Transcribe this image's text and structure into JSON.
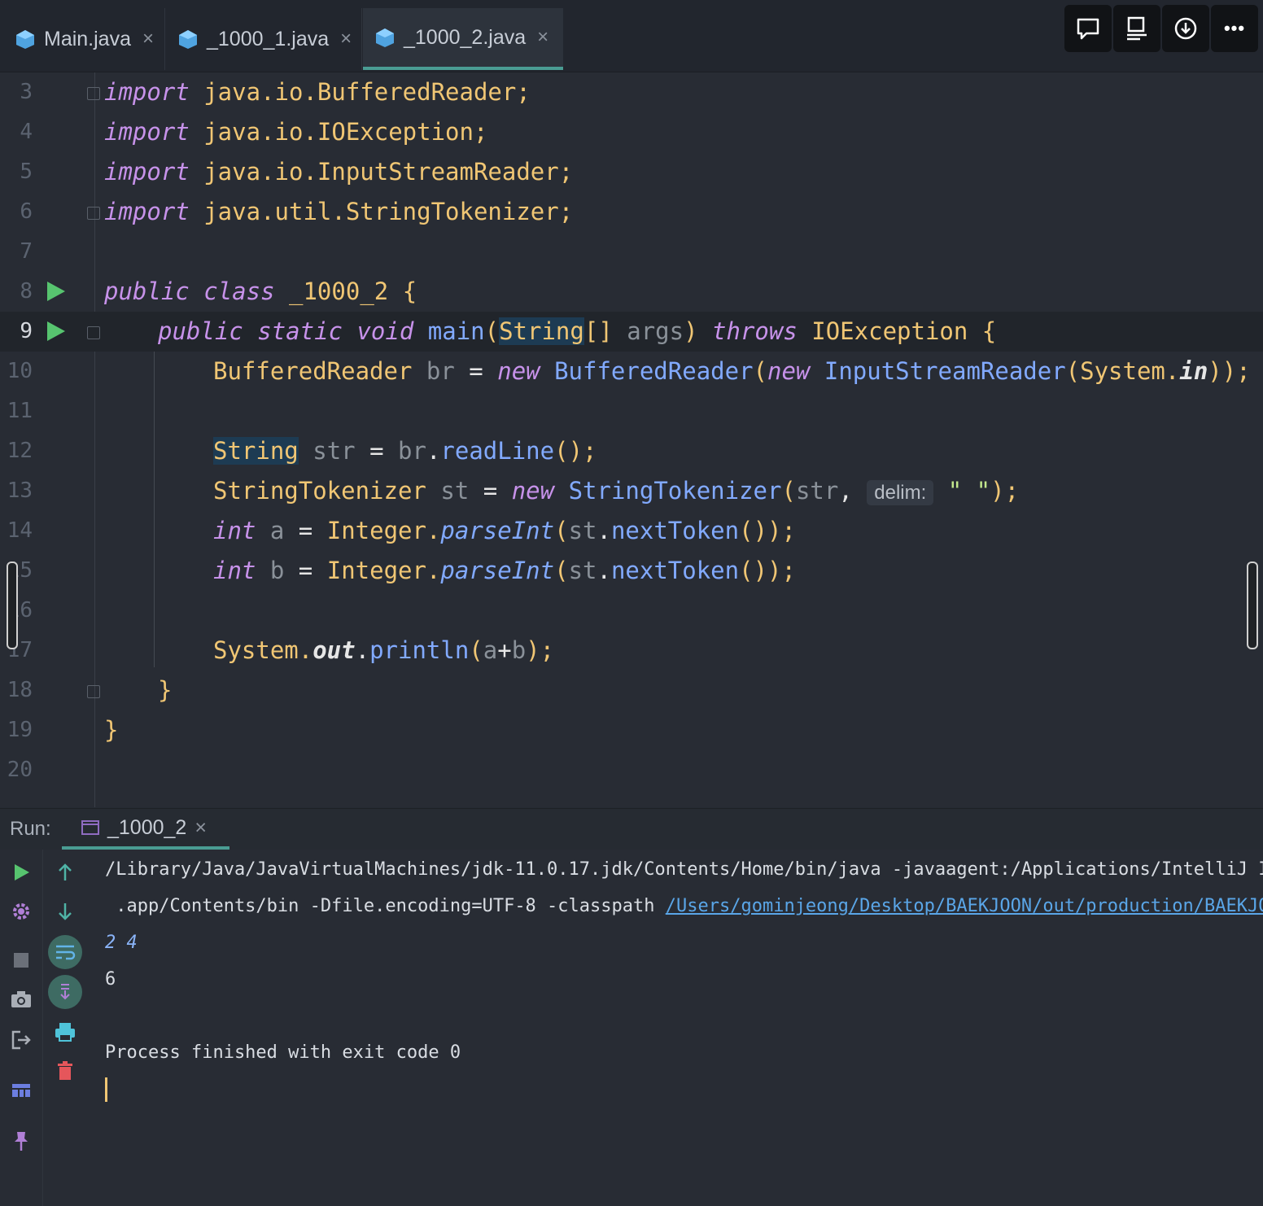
{
  "tabs": [
    {
      "label": "Main.java",
      "close": "×",
      "active": false
    },
    {
      "label": "_1000_1.java",
      "close": "×",
      "active": false
    },
    {
      "label": "_1000_2.java",
      "close": "×",
      "active": true
    }
  ],
  "toolbar": {
    "icons": [
      "comment-icon",
      "presentation-icon",
      "download-icon",
      "more-icon"
    ],
    "more_label": "•••"
  },
  "editor": {
    "line_numbers": [
      "3",
      "4",
      "5",
      "6",
      "7",
      "8",
      "9",
      "10",
      "11",
      "12",
      "13",
      "14",
      "15",
      "16",
      "17",
      "18",
      "19",
      "20"
    ],
    "current_line": "9",
    "lines": {
      "l3": {
        "kw": "import",
        "rest": " java.io.BufferedReader;"
      },
      "l4": {
        "kw": "import",
        "rest": " java.io.IOException;"
      },
      "l5": {
        "kw": "import",
        "rest": " java.io.InputStreamReader;"
      },
      "l6": {
        "kw": "import",
        "rest": " java.util.StringTokenizer;"
      },
      "l8": {
        "kw1": "public",
        "kw2": "class",
        "name": "_1000_2",
        "brace": "{"
      },
      "l9": {
        "kw1": "public",
        "kw2": "static",
        "kw3": "void",
        "fn": "main",
        "p1": "(",
        "type": "String",
        "arr": "[]",
        "arg": "args",
        "p2": ")",
        "kw4": "throws",
        "exc": "IOException",
        "brace": "{"
      },
      "l10": {
        "type": "BufferedReader",
        "var": "br",
        "eq": "=",
        "kw": "new",
        "cls": "BufferedReader",
        "p1": "(",
        "kw2": "new",
        "cls2": "InputStreamReader",
        "p2": "(System.",
        "field": "in",
        "end": "));"
      },
      "l12": {
        "type": "String",
        "var": "str",
        "eq": "=",
        "obj": "br",
        "dot": ".",
        "fn": "readLine",
        "end": "();"
      },
      "l13": {
        "type": "StringTokenizer",
        "var": "st",
        "eq": "=",
        "kw": "new",
        "cls": "StringTokenizer",
        "p1": "(",
        "arg": "str",
        "comma": ",",
        "hint": "delim:",
        "str": "\" \"",
        "end": ");"
      },
      "l14": {
        "kw": "int",
        "var": "a",
        "eq": "=",
        "cls": "Integer.",
        "fn": "parseInt",
        "p1": "(",
        "obj": "st",
        "dot": ".",
        "fn2": "nextToken",
        "end": "());"
      },
      "l15": {
        "kw": "int",
        "var": "b",
        "eq": "=",
        "cls": "Integer.",
        "fn": "parseInt",
        "p1": "(",
        "obj": "st",
        "dot": ".",
        "fn2": "nextToken",
        "end": "());"
      },
      "l17": {
        "cls": "System.",
        "field": "out",
        "dot": ".",
        "fn": "println",
        "p1": "(",
        "a": "a",
        "plus": "+",
        "b": "b",
        "end": ");"
      },
      "l18": {
        "brace": "}"
      },
      "l19": {
        "brace": "}"
      }
    }
  },
  "run": {
    "label": "Run:",
    "tab_label": "_1000_2",
    "tab_close": "×",
    "output": {
      "line1": "/Library/Java/JavaVirtualMachines/jdk-11.0.17.jdk/Contents/Home/bin/java -javaagent:/Applications/IntelliJ I",
      "line2_prefix": " .app/Contents/bin -Dfile.encoding=UTF-8 -classpath ",
      "line2_link": "/Users/gominjeong/Desktop/BAEKJOON/out/production/BAEKJOO",
      "input": "2 4",
      "result": "6",
      "finish": "Process finished with exit code 0"
    }
  },
  "colors": {
    "accent": "#4a9c93",
    "run_green": "#57c46f",
    "keyword": "#c792ea",
    "type": "#f0c674",
    "function": "#82aaff",
    "delete_red": "#e5565b"
  }
}
